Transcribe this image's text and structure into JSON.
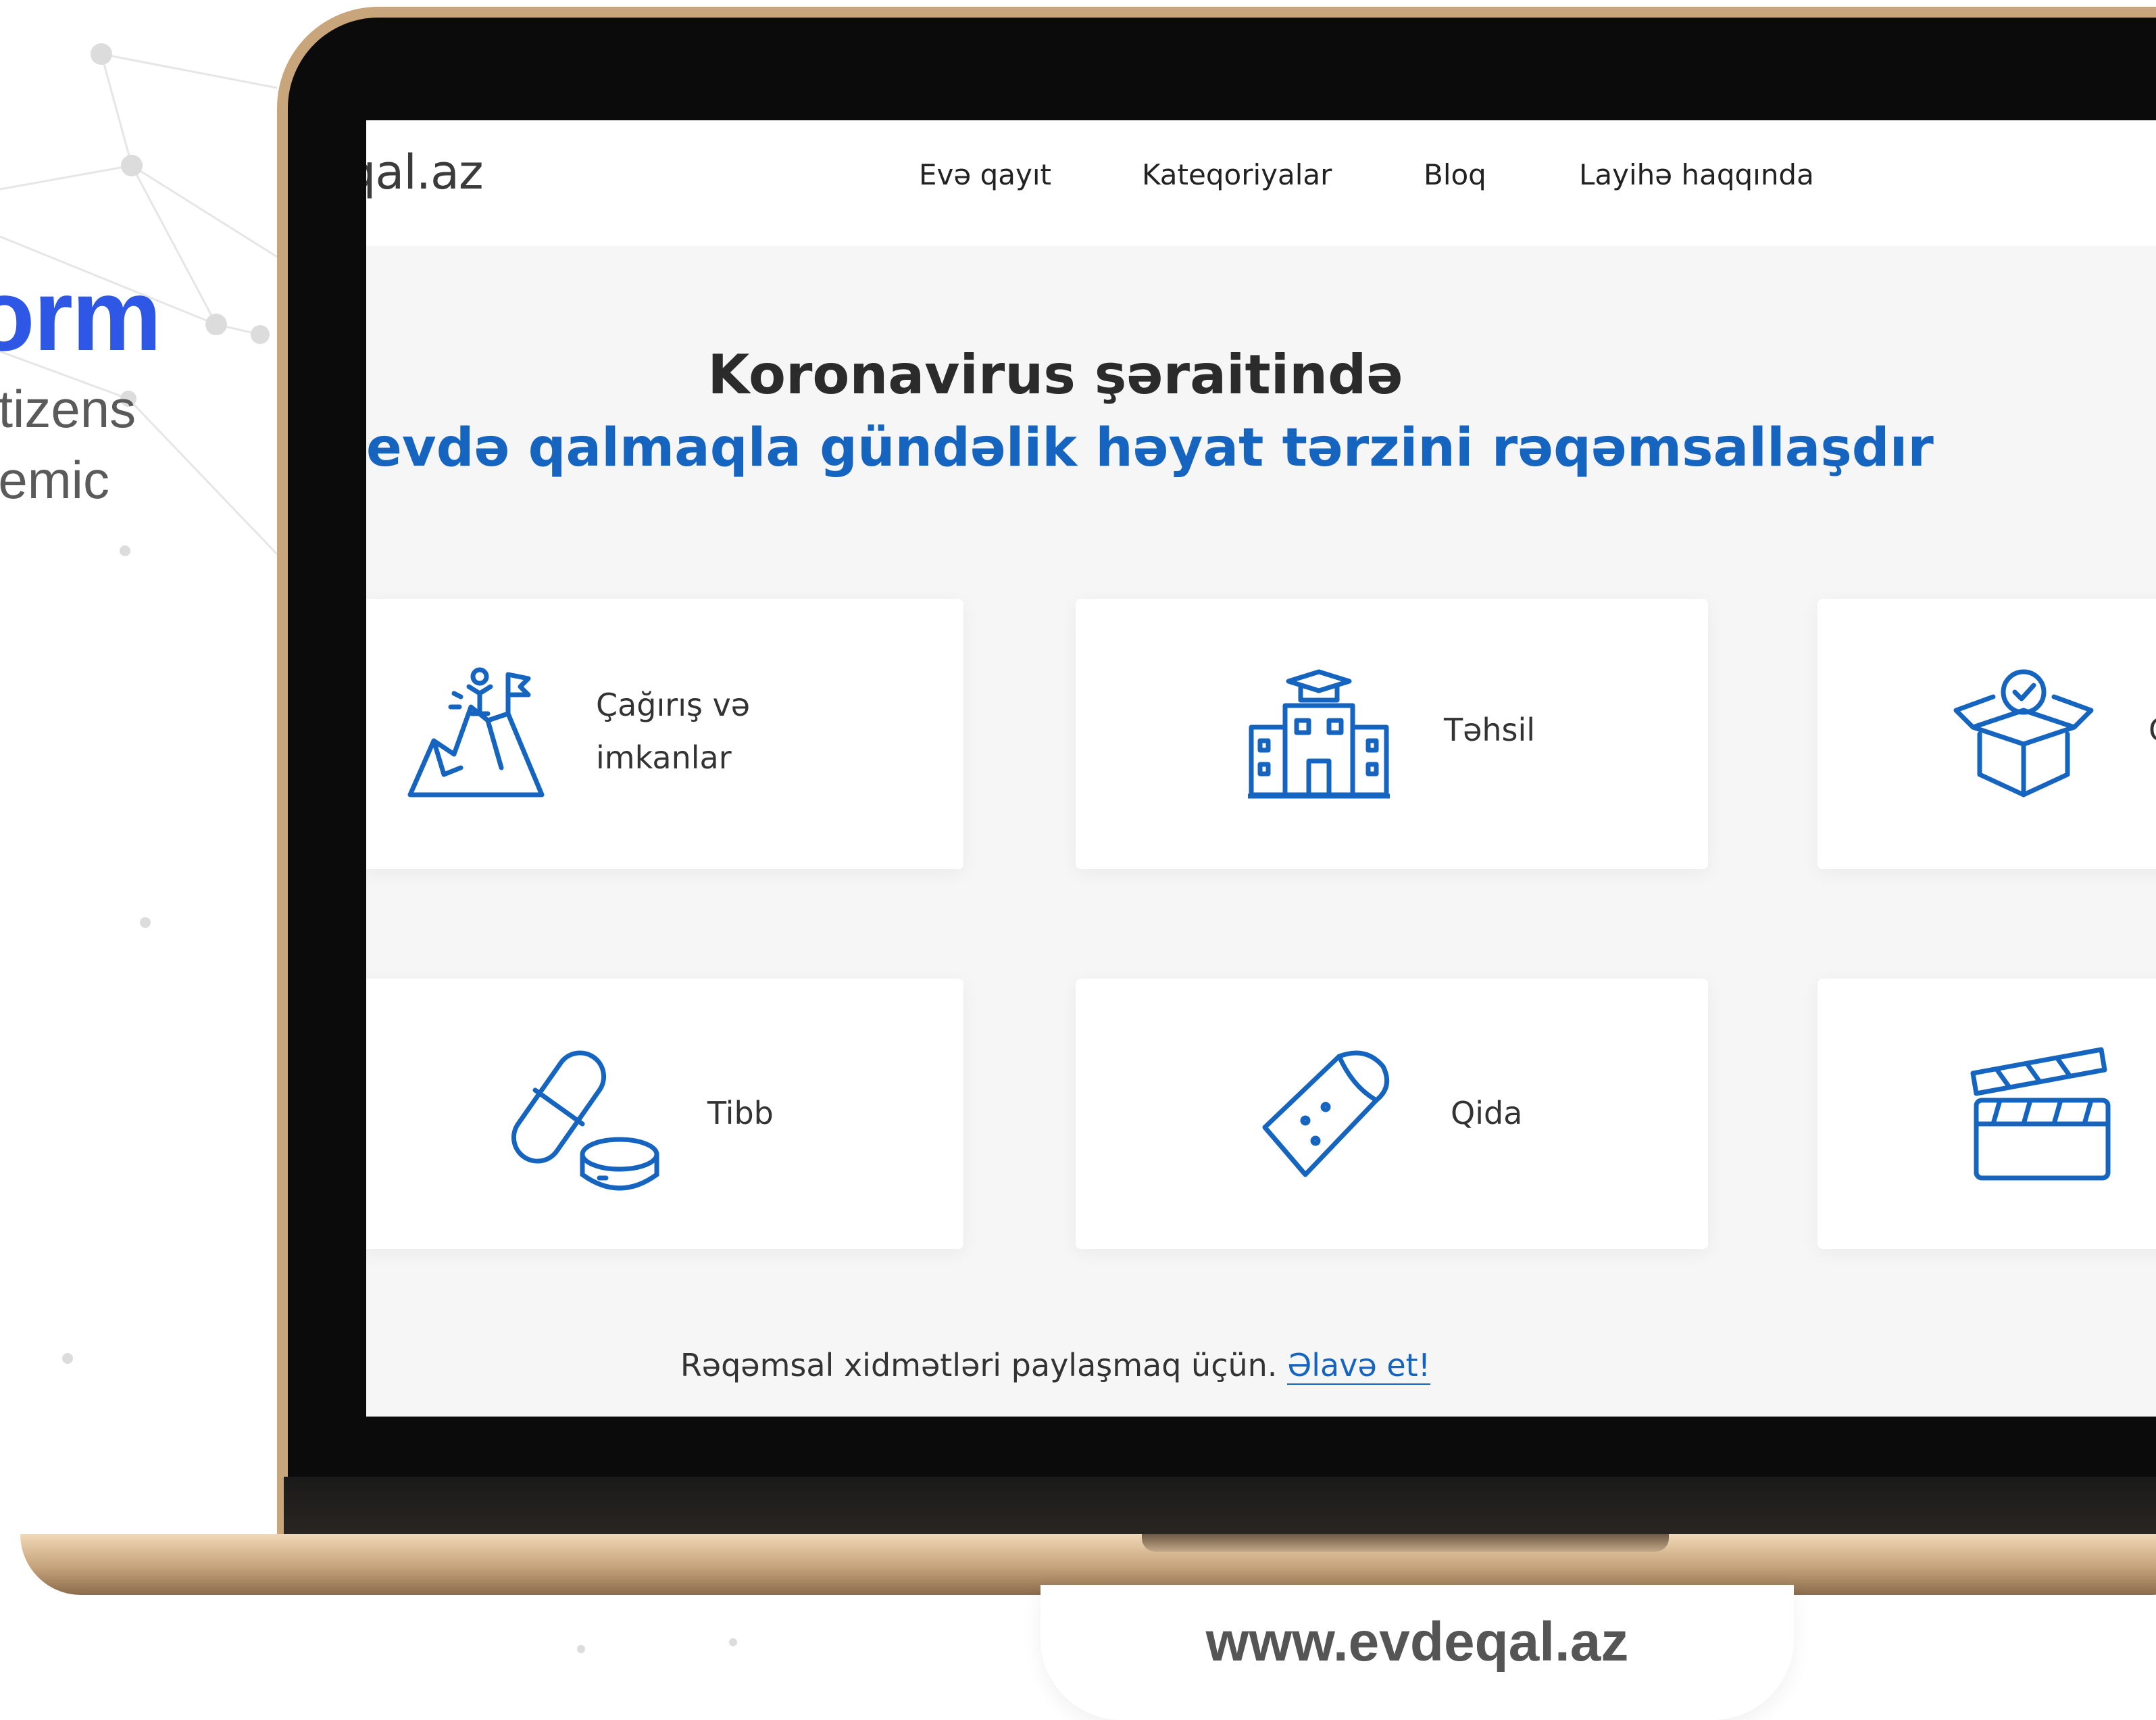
{
  "left_text": {
    "heading": "orm",
    "line1": "itizens",
    "line2": "lemic"
  },
  "site": {
    "logo": "qal.az",
    "nav": [
      "Evə qayıt",
      "Kateqoriyalar",
      "Bloq",
      "Layihə haqqında"
    ],
    "hero_line1": "Koronavirus şəraitində",
    "hero_line2": "evdə qalmaqla gündəlik həyat tərzini rəqəmsallaşdır",
    "cards": [
      {
        "line1": "Çağırış və",
        "line2": "imkanlar",
        "icon": "mountain-flag-icon"
      },
      {
        "label": "Təhsil",
        "icon": "school-building-icon"
      },
      {
        "label": "Ç",
        "icon": "open-box-check-icon"
      },
      {
        "label": "Tibb",
        "icon": "pill-icon"
      },
      {
        "label": "Qida",
        "icon": "burrito-icon"
      },
      {
        "label": "",
        "icon": "clapperboard-icon"
      }
    ],
    "footer_text": "Rəqəmsal xidmətləri paylaşmaq üçün.",
    "footer_link": "Əlavə et!"
  },
  "url": "www.evdeqal.az",
  "colors": {
    "accent_blue": "#1565c0",
    "heading_blue": "#2f57e6",
    "laptop_gold": "#c9a57c"
  }
}
